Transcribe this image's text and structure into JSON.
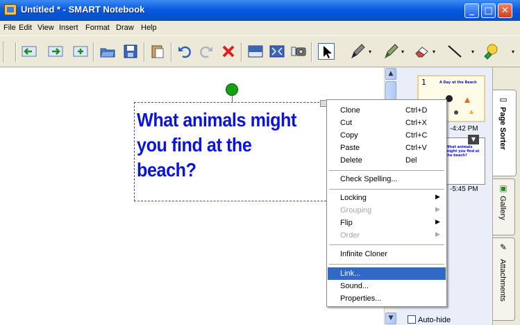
{
  "window": {
    "title": "Untitled * - SMART Notebook",
    "minimize": "_",
    "maximize": "□",
    "close": "✕"
  },
  "menubar": [
    "File",
    "Edit",
    "View",
    "Insert",
    "Format",
    "Draw",
    "Help"
  ],
  "toolbar": {
    "items": [
      "previous-page",
      "next-page",
      "add-page",
      "open",
      "save",
      "paste",
      "undo",
      "redo",
      "delete",
      "screen-shade",
      "full-screen",
      "capture",
      "select",
      "pen",
      "creative-pen",
      "eraser",
      "line",
      "fill"
    ]
  },
  "canvas": {
    "textbox_lines": [
      "What animals might",
      "you find at the",
      "beach?"
    ],
    "text_color": "#0b13df"
  },
  "page_sorter": {
    "pages": [
      {
        "number": "1",
        "title": "A Day at the Beach",
        "time": "-4:42 PM"
      },
      {
        "number": "",
        "title": "What animals might you find at the beach?",
        "time": "-5:45 PM"
      }
    ],
    "autohide_label": "Auto-hide"
  },
  "sidetabs": [
    "Page Sorter",
    "Gallery",
    "Attachments"
  ],
  "context_menu": {
    "groups": [
      [
        {
          "label": "Clone",
          "shortcut": "Ctrl+D"
        },
        {
          "label": "Cut",
          "shortcut": "Ctrl+X"
        },
        {
          "label": "Copy",
          "shortcut": "Ctrl+C"
        },
        {
          "label": "Paste",
          "shortcut": "Ctrl+V"
        },
        {
          "label": "Delete",
          "shortcut": "Del"
        }
      ],
      [
        {
          "label": "Check Spelling..."
        }
      ],
      [
        {
          "label": "Locking",
          "submenu": true
        },
        {
          "label": "Grouping",
          "submenu": true,
          "disabled": true
        },
        {
          "label": "Flip",
          "submenu": true
        },
        {
          "label": "Order",
          "submenu": true,
          "disabled": true
        }
      ],
      [
        {
          "label": "Infinite Cloner"
        }
      ],
      [
        {
          "label": "Link...",
          "highlighted": true
        },
        {
          "label": "Sound..."
        },
        {
          "label": "Properties..."
        }
      ]
    ]
  },
  "colors": {
    "titlebar": "#0a5de0",
    "highlight": "#316ac5",
    "panel": "#e9eef8"
  }
}
